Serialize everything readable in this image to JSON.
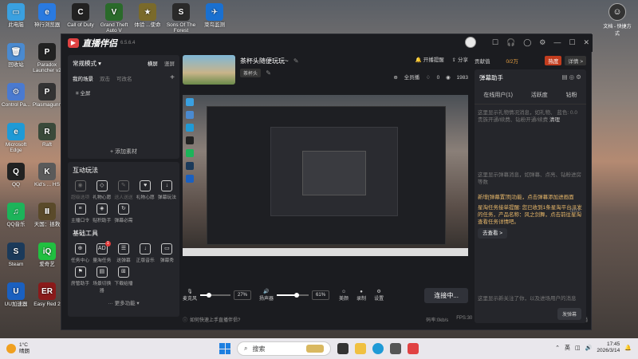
{
  "desktop": {
    "icons_left": [
      {
        "label": "此电脑",
        "color": "#3aa0e0",
        "glyph": "▭"
      },
      {
        "label": "回收站",
        "color": "#4a8ad0",
        "glyph": "🗑"
      },
      {
        "label": "Control Pa...",
        "color": "#4a7ad0",
        "glyph": "⚙"
      },
      {
        "label": "Microsoft Edge",
        "color": "#1f9ad6",
        "glyph": "e"
      },
      {
        "label": "QQ",
        "color": "#222",
        "glyph": "Q"
      },
      {
        "label": "QQ音乐",
        "color": "#1cb45a",
        "glyph": "♫"
      },
      {
        "label": "Steam",
        "color": "#1b3a5a",
        "glyph": "S"
      },
      {
        "label": "UU加速器",
        "color": "#1a60c0",
        "glyph": "U"
      }
    ],
    "icons_col2": [
      {
        "label": "神行浏览器",
        "color": "#2a7ae0",
        "glyph": "e"
      },
      {
        "label": "Paradox Launcher v2",
        "color": "#222",
        "glyph": "P"
      },
      {
        "label": "Plasmagunn",
        "color": "#333",
        "glyph": "P"
      },
      {
        "label": "Raft",
        "color": "#3a4a3a",
        "glyph": "R"
      },
      {
        "label": "Kid's ... HS",
        "color": "#5a5a5a",
        "glyph": "K"
      },
      {
        "label": "天国：拯救",
        "color": "#5a4a2a",
        "glyph": "Ⅱ"
      },
      {
        "label": "爱奇艺",
        "color": "#20c040",
        "glyph": "iQ"
      },
      {
        "label": "Easy Red 2",
        "color": "#8a1a1a",
        "glyph": "ER"
      }
    ],
    "icons_top": [
      {
        "label": "Call of Duty",
        "color": "#222",
        "glyph": "C"
      },
      {
        "label": "Grand Theft Auto V",
        "color": "#2a6a2a",
        "glyph": "V"
      },
      {
        "label": "体验 ...使命",
        "color": "#7a6a2a",
        "glyph": "★"
      },
      {
        "label": "Sons Of The Forest",
        "color": "#2a2a2a",
        "glyph": "S"
      },
      {
        "label": "菜鸟监测",
        "color": "#1a70d0",
        "glyph": "✈"
      }
    ],
    "user_tray": {
      "label": "文档 - 快捷方式",
      "glyph": "☺"
    }
  },
  "app": {
    "name": "直播伴侣",
    "version": "6.5.6.4",
    "window_controls": [
      "☐",
      "🎧",
      "◯",
      "⚙",
      "—",
      "☐",
      "✕"
    ],
    "left": {
      "mode": "常规模式 ▾",
      "mode_tabs": [
        "横屏",
        "竖屏"
      ],
      "scene_tabs": [
        "我的场景",
        "双击",
        "可改名"
      ],
      "scene_add": "+",
      "scene_item": "全屏",
      "add_material": "+ 添加素材",
      "interactive_title": "互动玩法",
      "interactive_tools": [
        {
          "label": "超级选项",
          "icon": "◉",
          "dim": true
        },
        {
          "label": "礼物心愿",
          "icon": "◇",
          "dim": false
        },
        {
          "label": "送人送送",
          "icon": "✎",
          "dim": true
        },
        {
          "label": "礼物心愿",
          "icon": "♥",
          "dim": false
        },
        {
          "label": "弹幕玩法",
          "icon": "↓",
          "dim": false
        },
        {
          "label": "主播口令",
          "icon": "≡",
          "dim": false
        },
        {
          "label": "贴积助手",
          "icon": "◈",
          "dim": false
        },
        {
          "label": "弹幕必需",
          "icon": "↻",
          "dim": false
        }
      ],
      "basic_title": "基础工具",
      "basic_tools": [
        {
          "label": "任务中心",
          "icon": "⊕",
          "badge": ""
        },
        {
          "label": "量淘任务",
          "icon": "AD",
          "badge": "1"
        },
        {
          "label": "送弹幕",
          "icon": "☰",
          "badge": ""
        },
        {
          "label": "正版音乐",
          "icon": "↓",
          "badge": ""
        },
        {
          "label": "弹幕秀",
          "icon": "▭",
          "badge": ""
        },
        {
          "label": "房管助手",
          "icon": "⚑",
          "badge": ""
        },
        {
          "label": "场景切换器",
          "icon": "▤",
          "badge": ""
        },
        {
          "label": "下载给播",
          "icon": "⊞",
          "badge": ""
        }
      ],
      "more": "··· 更多功能 ▾"
    },
    "center": {
      "title": "茶杯头随便玩玩~",
      "tag": "茶杯头",
      "start_live": "开播提醒",
      "share": "分享",
      "visibility": "全员播",
      "likes": "0",
      "viewers": "1983",
      "mic_label": "麦克风",
      "mic_pct": "27%",
      "speaker_label": "扬声器",
      "speaker_pct": "61%",
      "effects": [
        {
          "label": "美颜",
          "icon": "☺"
        },
        {
          "label": "录制",
          "icon": "●"
        },
        {
          "label": "设置",
          "icon": "⚙"
        }
      ],
      "connect": "连接中...",
      "help": "如何快速上手直播伴侣?",
      "stats": [
        "码率:0kb/s",
        "FPS:30",
        "丢帧:0(0.00%)",
        "CPU:4%",
        "内存:41%",
        "未开播"
      ]
    },
    "right": {
      "contrib": "贡献值",
      "rank_count": "0/2万",
      "hot": "热度",
      "details": "详情 >",
      "danmu_title": "弹幕助手",
      "danmu_tabs": [
        "在线用户(1)",
        "活跃度",
        "钻粉"
      ],
      "msg1": "这里显示礼物情况消息，如礼物、",
      "msg1b": "蓝色: 0.0",
      "msg2": "贵族开通/续费、钻粉开通/续费",
      "clear": "清理",
      "count": "0/0人",
      "msg3": "这里显示弹幕消息，如弹幕、点亮、钻粉进房等数",
      "notice1": "新增[弹幕置顶]功能，点击弹幕添加进画面",
      "notice2": "星淘任务接单提醒: 您已收到1条星淘平台派发的任务，产品名称：风之剑舞，点击前往星淘查看任务详情吧。",
      "notice_btn": "去查看 >",
      "foot": "这里显示新关注了你，以及进场用户的消息",
      "send_btn": "发弹幕"
    }
  },
  "taskbar": {
    "weather_temp": "1°C",
    "weather_desc": "晴朗",
    "search": "搜索",
    "lang": "英",
    "time": "17:45",
    "date": "2026/3/14"
  }
}
